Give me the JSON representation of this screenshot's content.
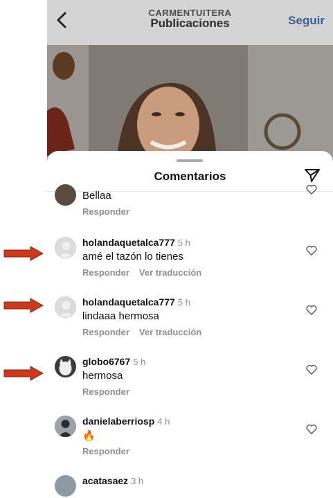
{
  "header": {
    "account_name": "CARMENTUITERA",
    "title": "Publicaciones",
    "follow_label": "Seguir",
    "back_icon": "chevron-left-icon"
  },
  "comments_sheet": {
    "title": "Comentarios",
    "share_icon": "paper-plane-icon"
  },
  "comments": [
    {
      "username": "",
      "time": "",
      "text": "Bellaa",
      "reply_label": "Responder",
      "translate_label": ""
    },
    {
      "username": "holandaquetalca777",
      "time": "5 h",
      "text": "amé el tazón lo tienes",
      "reply_label": "Responder",
      "translate_label": "Ver traducción"
    },
    {
      "username": "holandaquetalca777",
      "time": "5 h",
      "text": "lindaaa hermosa",
      "reply_label": "Responder",
      "translate_label": "Ver traducción"
    },
    {
      "username": "globo6767",
      "time": "5 h",
      "text": "hermosa",
      "reply_label": "Responder",
      "translate_label": ""
    },
    {
      "username": "danielaberriosp",
      "time": "4 h",
      "text": "🔥",
      "reply_label": "Responder",
      "translate_label": ""
    },
    {
      "username": "acatasaez",
      "time": "3 h",
      "text": "",
      "reply_label": "",
      "translate_label": ""
    }
  ],
  "colors": {
    "annotation_arrow": "#cc3a1e",
    "follow": "#3a5f91",
    "secondary_text": "#8e8e8e"
  }
}
